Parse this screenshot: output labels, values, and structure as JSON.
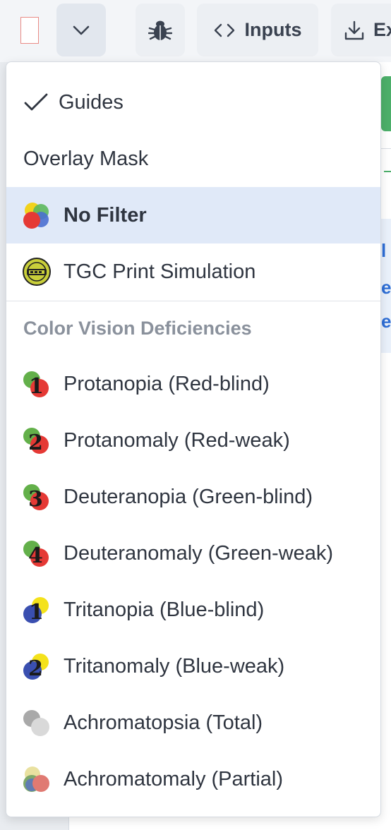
{
  "toolbar": {
    "inputs_label": "Inputs",
    "export_label": "Ex"
  },
  "background": {
    "letters": [
      "l",
      "e",
      "e"
    ]
  },
  "menu": {
    "guides": {
      "label": "Guides",
      "checked": true
    },
    "overlay_mask": {
      "label": "Overlay Mask"
    },
    "no_filter": {
      "label": "No Filter",
      "selected": true
    },
    "tgc_print": {
      "label": "TGC Print Simulation"
    },
    "section_label": "Color Vision Deficiencies",
    "cvd_items": [
      {
        "label": "Protanopia (Red-blind)",
        "icon": "protanopia-icon",
        "num": "1"
      },
      {
        "label": "Protanomaly (Red-weak)",
        "icon": "protanomaly-icon",
        "num": "2"
      },
      {
        "label": "Deuteranopia (Green-blind)",
        "icon": "deuteranopia-icon",
        "num": "3"
      },
      {
        "label": "Deuteranomaly (Green-weak)",
        "icon": "deuteranomaly-icon",
        "num": "4"
      },
      {
        "label": "Tritanopia (Blue-blind)",
        "icon": "tritanopia-icon",
        "num": "1"
      },
      {
        "label": "Tritanomaly (Blue-weak)",
        "icon": "tritanomaly-icon",
        "num": "2"
      },
      {
        "label": "Achromatopsia (Total)",
        "icon": "achromatopsia-icon"
      },
      {
        "label": "Achromatomaly (Partial)",
        "icon": "achromatomaly-icon"
      }
    ]
  },
  "colors": {
    "selected_bg": "#e0e9f8",
    "accent_green": "#4caf6a",
    "accent_blue": "#2f6fd6"
  }
}
